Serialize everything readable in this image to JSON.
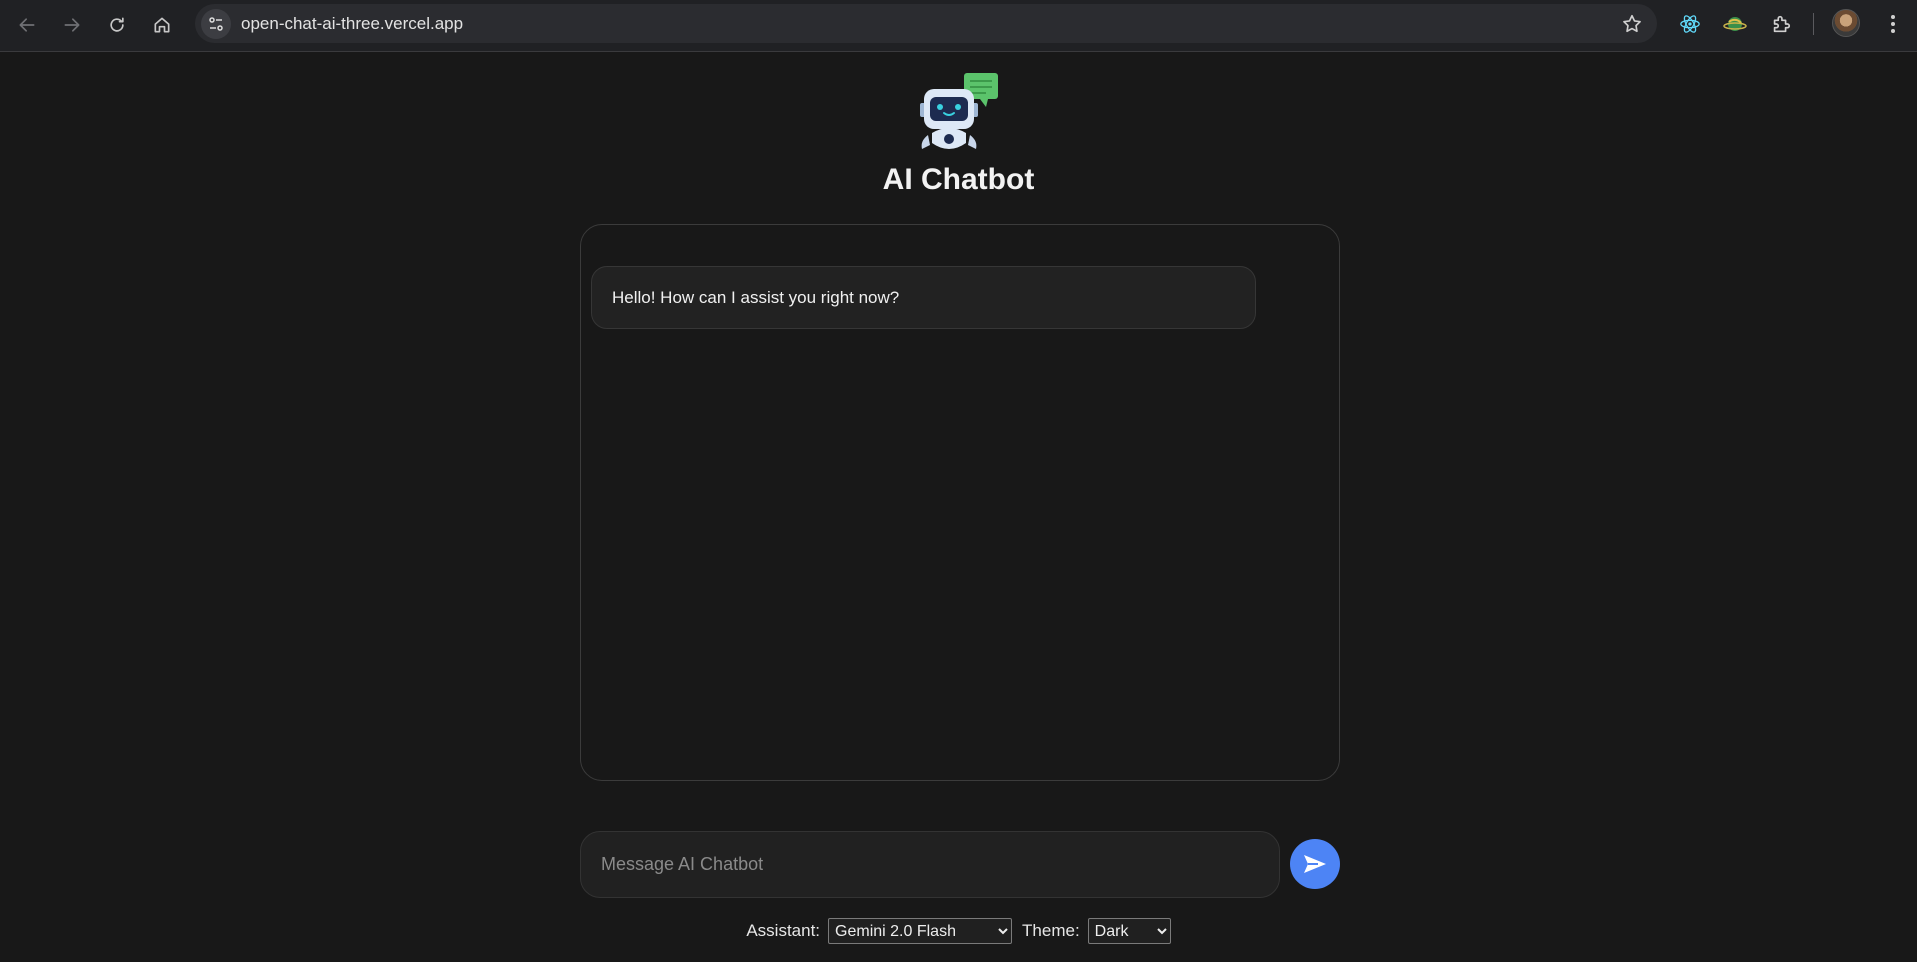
{
  "browser": {
    "url": "open-chat-ai-three.vercel.app",
    "nav_icons": [
      "back-arrow-icon",
      "forward-arrow-icon",
      "reload-icon",
      "home-icon"
    ],
    "extension_icons": [
      "react-devtools-icon",
      "planet-extension-icon",
      "puzzle-extensions-icon"
    ]
  },
  "app": {
    "title": "AI Chatbot",
    "accent_color": "#4d84f5",
    "messages": [
      {
        "role": "assistant",
        "text": "Hello! How can I assist you right now?"
      }
    ],
    "input": {
      "placeholder": "Message AI Chatbot",
      "value": ""
    },
    "controls": {
      "assistant_label": "Assistant:",
      "assistant_selected": "Gemini 2.0 Flash",
      "theme_label": "Theme:",
      "theme_selected": "Dark"
    }
  }
}
